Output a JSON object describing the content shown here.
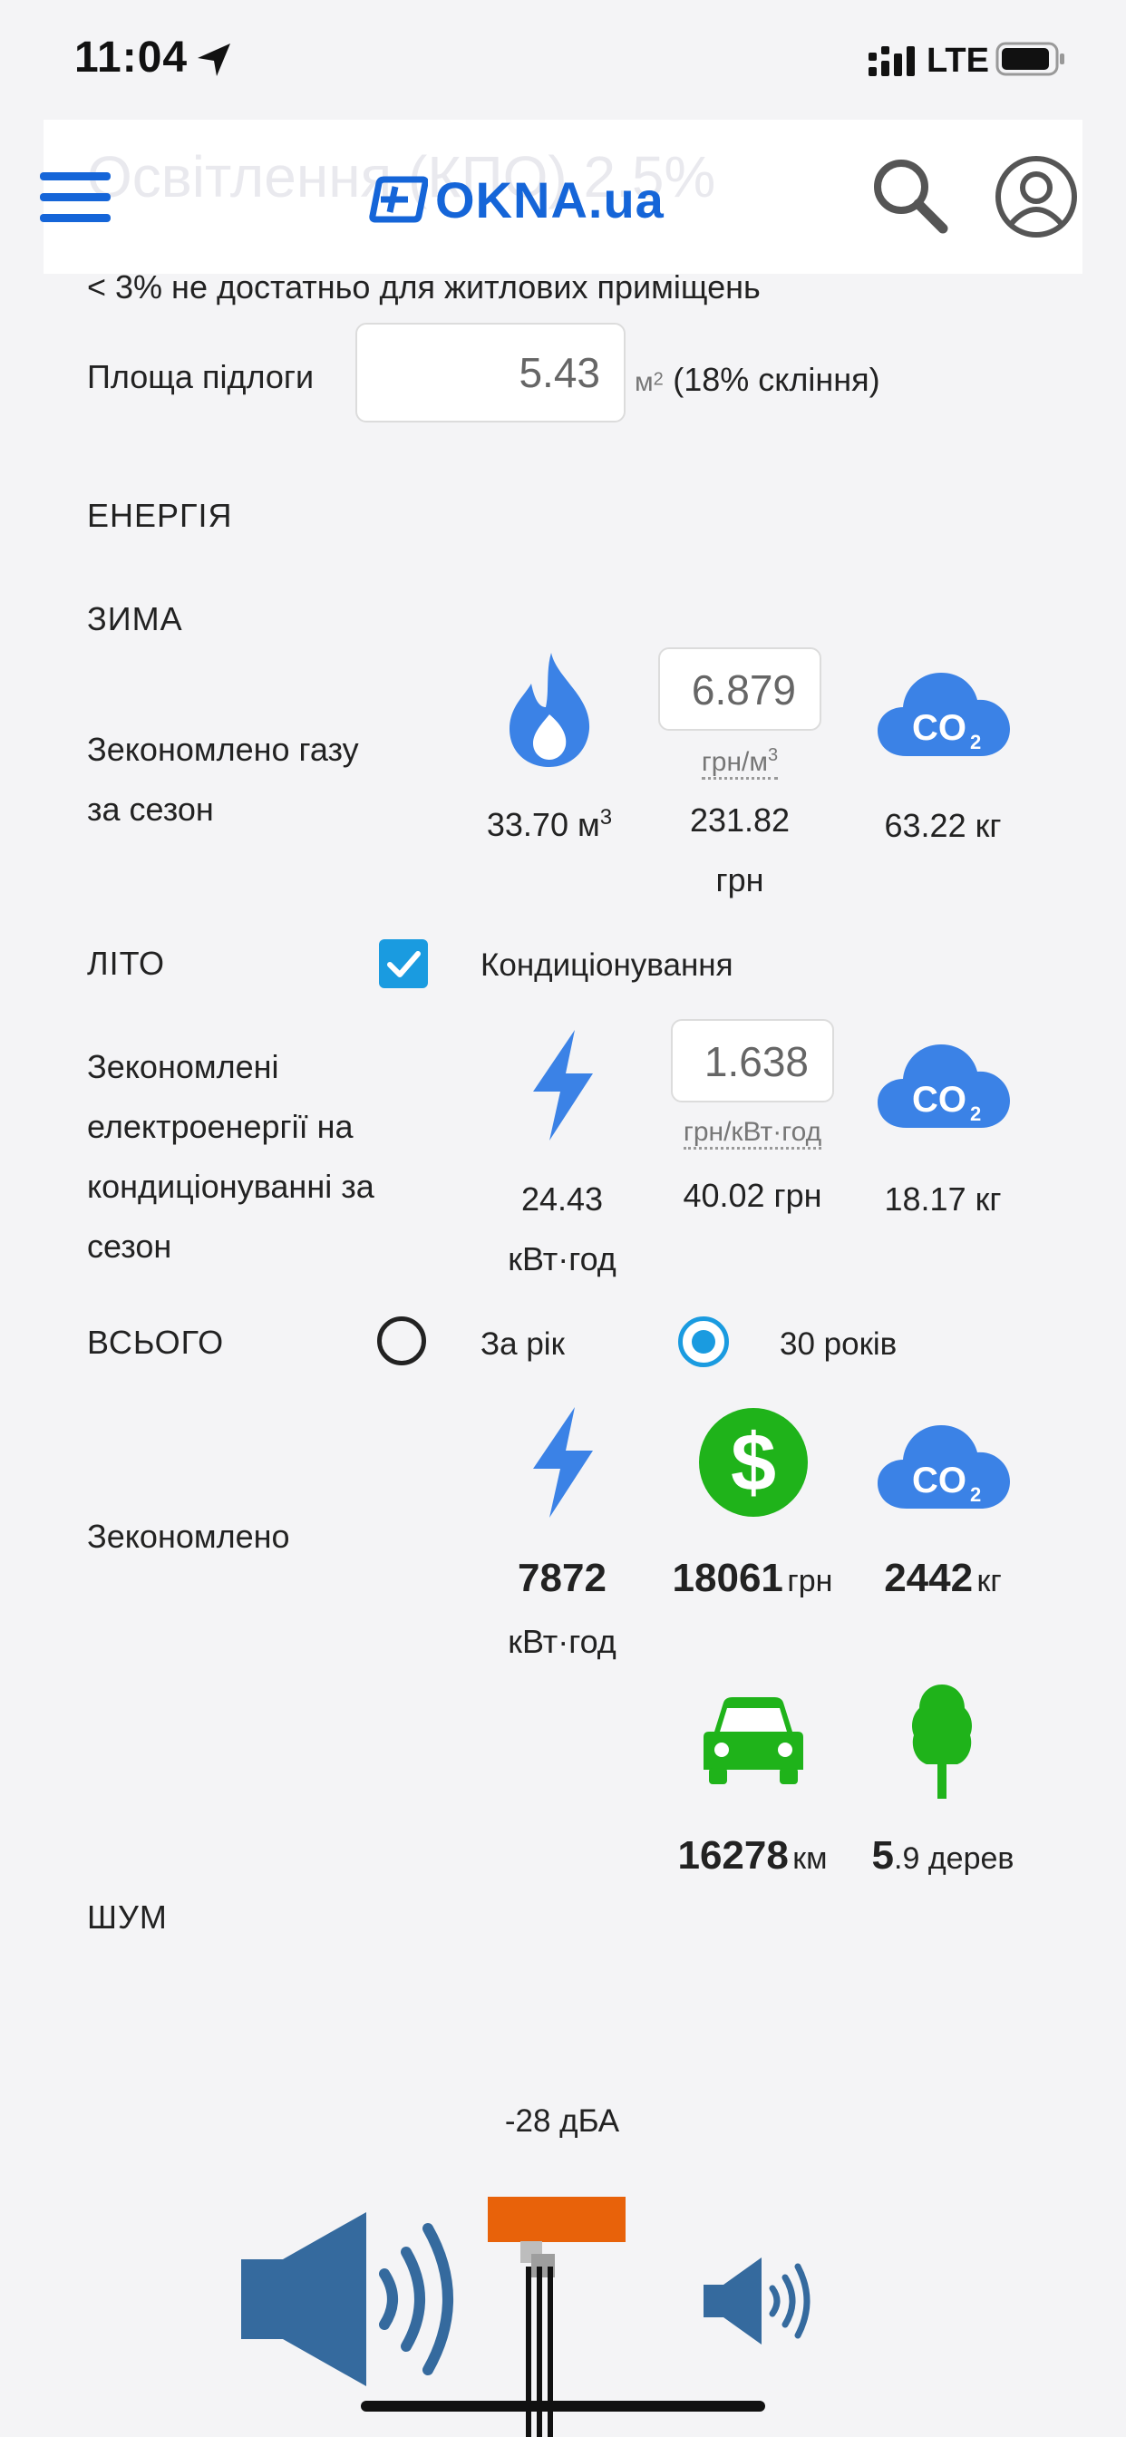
{
  "status": {
    "time": "11:04",
    "network": "LTE"
  },
  "header": {
    "ghost_text": "Освітлення (КПО)   2.5%",
    "logo": "OKNA.ua"
  },
  "lighting": {
    "note": "< 3% не достатньо для житлових приміщень"
  },
  "floor": {
    "label": "Площа підлоги",
    "value": "5.43",
    "unit": "м",
    "unit_sup": "2",
    "note": "(18% скління)"
  },
  "energy": {
    "title": "ЕНЕРГІЯ"
  },
  "winter": {
    "title": "ЗИМА",
    "label_line1": "Зекономлено газу",
    "label_line2": "за сезон",
    "gas_amount": "33.70 м",
    "gas_sup": "3",
    "price_value": "6.879",
    "price_unit": "грн/м",
    "price_unit_sup": "3",
    "cost_line1": "231.82",
    "cost_line2": "грн",
    "co2": "63.22 кг"
  },
  "summer": {
    "title": "ЛІТО",
    "ac_label": "Кондиціонування",
    "ac_checked": true,
    "label_lines": [
      "Зекономлені",
      "електроенергії на",
      "кондиціонуванні за",
      "сезон"
    ],
    "energy_line1": "24.43",
    "energy_line2": "кВт·год",
    "price_value": "1.638",
    "price_unit": "грн/кВт·год",
    "cost": "40.02 грн",
    "co2": "18.17 кг"
  },
  "total": {
    "title": "ВСЬОГО",
    "option_year": "За рік",
    "option_30": "30 років",
    "selected": "30 років",
    "label": "Зекономлено",
    "energy_value": "7872",
    "energy_unit": "кВт·год",
    "money_value": "18061",
    "money_unit": "грн",
    "co2_value": "2442",
    "co2_unit": "кг",
    "car_value": "16278",
    "car_unit": "км",
    "trees_value": "5",
    "trees_unit": ".9 дерев"
  },
  "noise": {
    "title": "ШУМ",
    "reduction": "-28 дБА"
  },
  "colors": {
    "accent_blue": "#1565d8",
    "icon_blue": "#3b82e6",
    "green": "#1fb31a",
    "orange": "#e8620a",
    "speaker_blue": "#356a9e",
    "checkbox_blue": "#1a9be0"
  }
}
